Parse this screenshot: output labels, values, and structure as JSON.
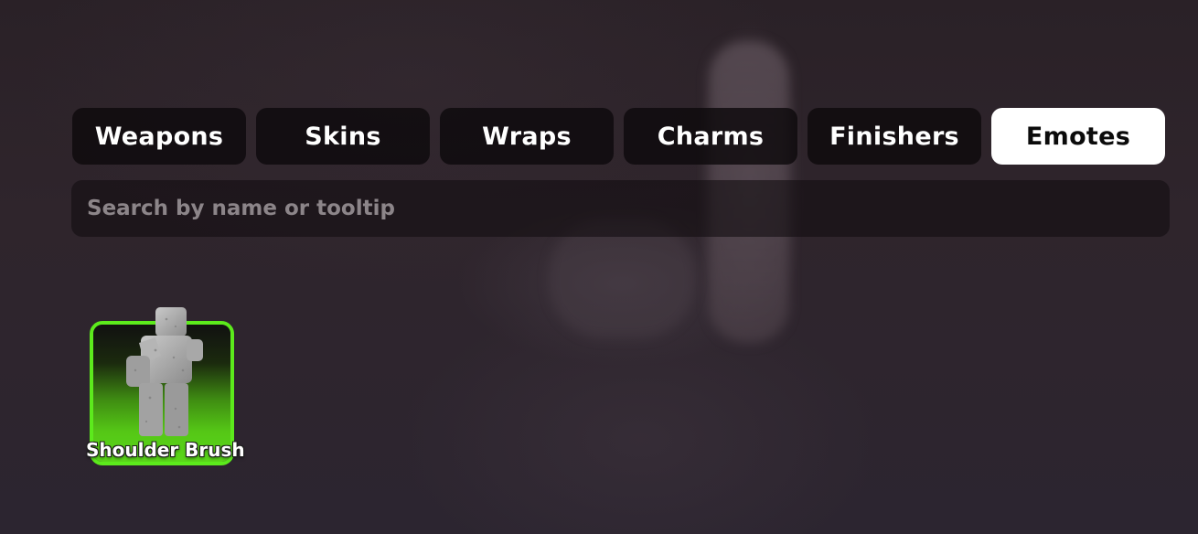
{
  "tabs": [
    {
      "label": "Weapons",
      "active": false
    },
    {
      "label": "Skins",
      "active": false
    },
    {
      "label": "Wraps",
      "active": false
    },
    {
      "label": "Charms",
      "active": false
    },
    {
      "label": "Finishers",
      "active": false
    },
    {
      "label": "Emotes",
      "active": true
    }
  ],
  "search": {
    "placeholder": "Search by name or tooltip",
    "value": ""
  },
  "items": [
    {
      "name": "Shoulder Brush",
      "icon": "emote-figure-icon",
      "rarity_color": "#5cea1c"
    }
  ]
}
